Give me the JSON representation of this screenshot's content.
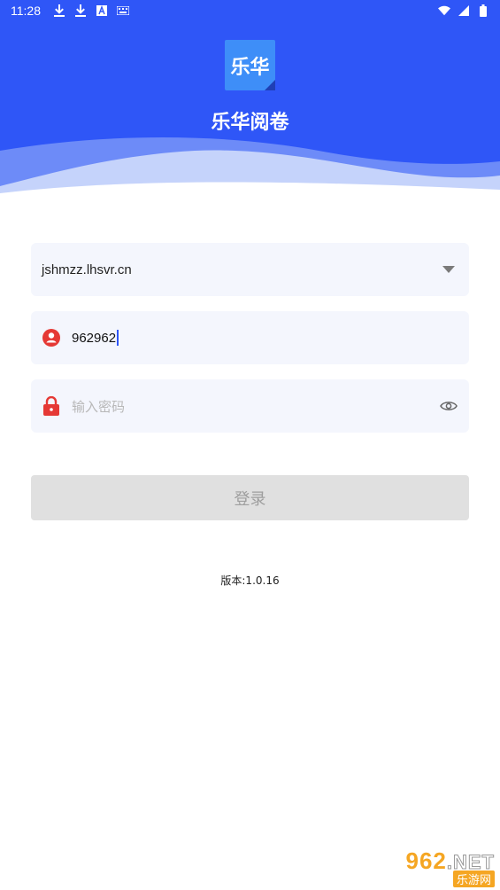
{
  "status_bar": {
    "time": "11:28",
    "icons_left": [
      "download-icon",
      "download-icon",
      "a-icon",
      "keyboard-icon"
    ],
    "icons_right": [
      "wifi-icon",
      "signal-icon",
      "battery-icon"
    ]
  },
  "header": {
    "logo_text": "乐华",
    "app_title": "乐华阅卷",
    "colors": {
      "primary": "#2f56f7",
      "wave_light": "#c5d3fb",
      "wave_mid": "#6d8bf8"
    }
  },
  "form": {
    "server": {
      "value": "jshmzz.lhsvr.cn",
      "icon": "chevron-down-icon"
    },
    "username": {
      "value": "962962",
      "icon": "user-icon",
      "icon_color": "#e53935"
    },
    "password": {
      "placeholder": "输入密码",
      "icon": "lock-icon",
      "icon_color": "#e53935",
      "toggle_icon": "eye-icon"
    },
    "login_label": "登录"
  },
  "footer": {
    "version": "版本:1.0.16"
  },
  "watermark": {
    "top": "962",
    "net": ".NET",
    "bottom": "乐游网"
  }
}
